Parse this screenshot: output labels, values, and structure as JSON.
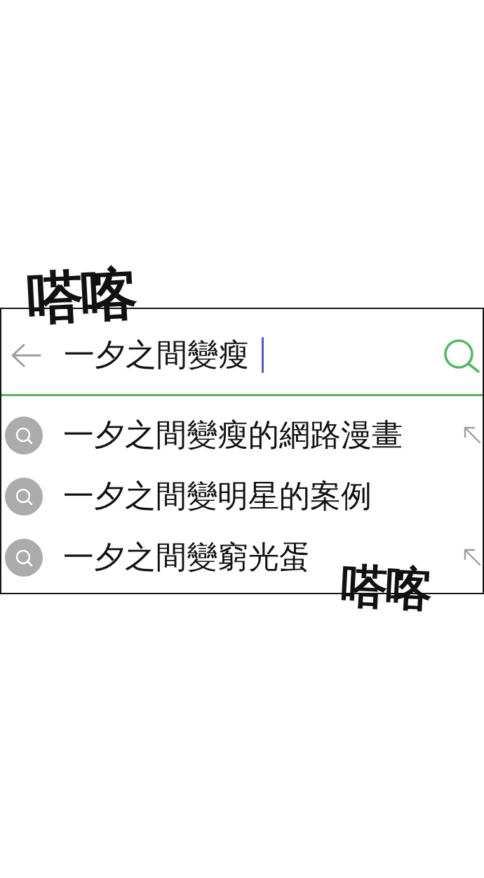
{
  "top_sound_effect": "嗒喀",
  "search_bar": {
    "query": "一夕之間變瘦",
    "cursor_visible": true
  },
  "suggestions": [
    {
      "text": "一夕之間變瘦的網路漫畫",
      "fill_arrow": true
    },
    {
      "text": "一夕之間變明星的案例",
      "fill_arrow": false
    },
    {
      "text": "一夕之間變窮光蛋",
      "fill_arrow": true
    }
  ],
  "bottom_sound_effect": "嗒喀"
}
